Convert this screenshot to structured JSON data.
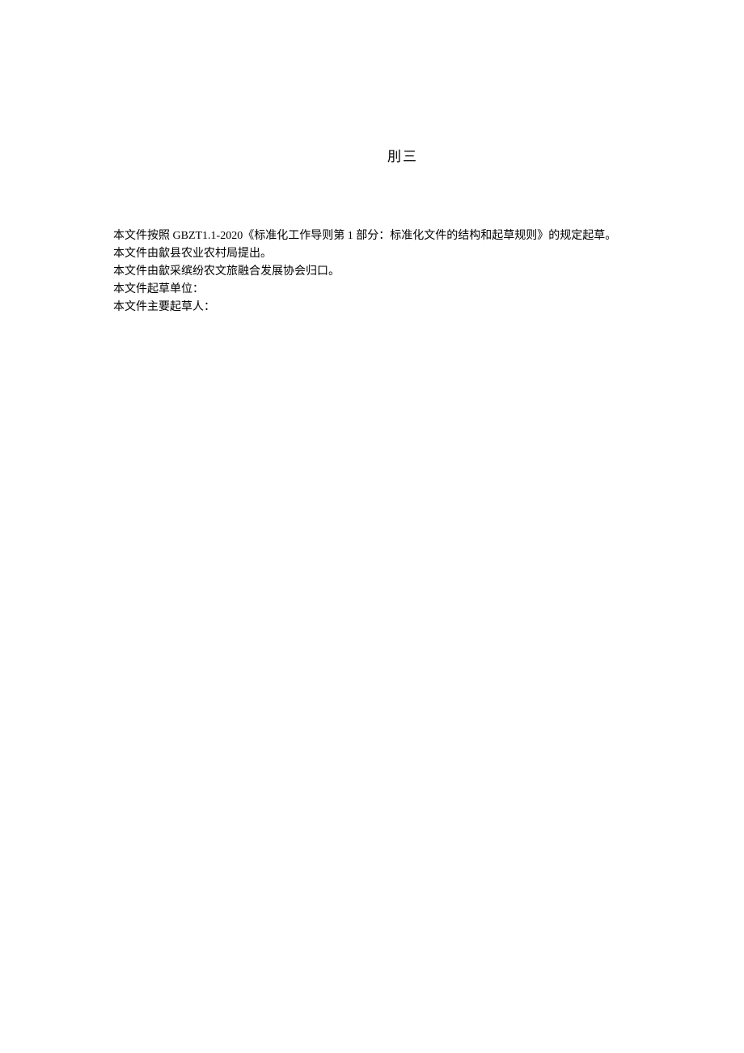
{
  "title": "刖三",
  "paragraphs": [
    "本文件按照 GBZT1.1-2020《标准化工作导则第 1 部分：标准化文件的结构和起草规则》的规定起草。",
    "本文件由歙县农业农村局提出。",
    "本文件由歙采缤纷农文旅融合发展协会归口。",
    "本文件起草单位：",
    "本文件主要起草人："
  ]
}
